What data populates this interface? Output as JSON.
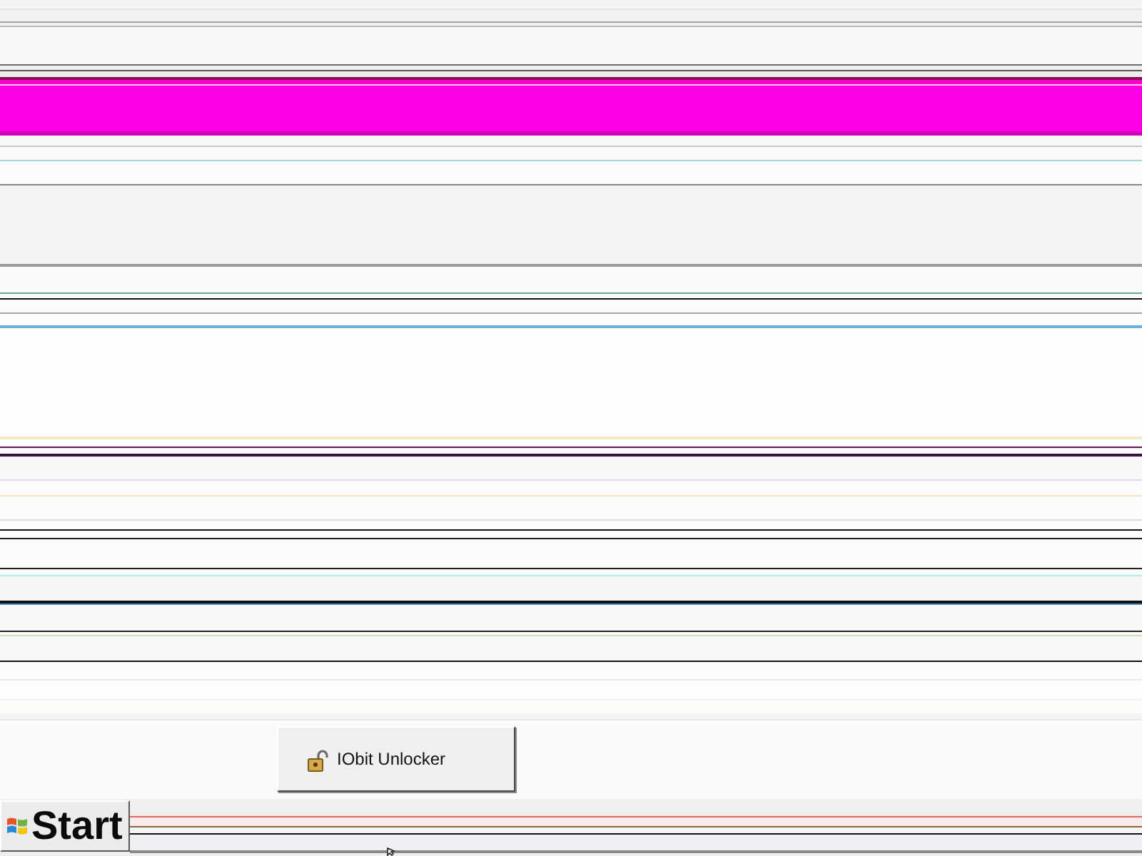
{
  "floating_button": {
    "label": "IObit Unlocker"
  },
  "taskbar": {
    "start_button": {
      "label": "Start"
    }
  }
}
